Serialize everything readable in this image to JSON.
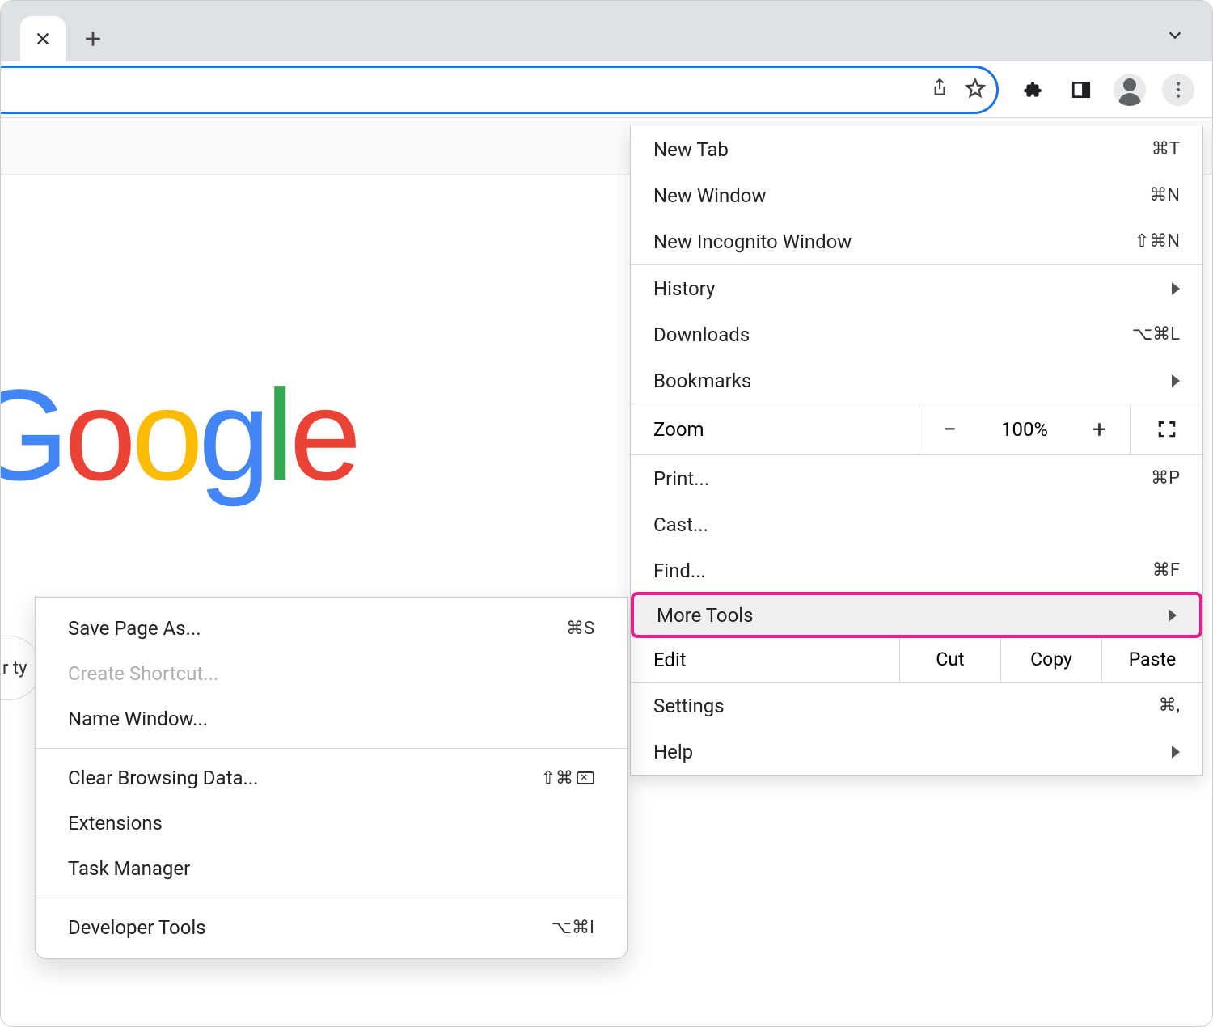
{
  "page": {
    "logo_chars": [
      "G",
      "o",
      "o",
      "g",
      "l",
      "e"
    ],
    "search_fragment": "r ty"
  },
  "menu": {
    "new_tab": {
      "label": "New Tab",
      "shortcut": "⌘T"
    },
    "new_window": {
      "label": "New Window",
      "shortcut": "⌘N"
    },
    "new_incognito": {
      "label": "New Incognito Window",
      "shortcut": "⇧⌘N"
    },
    "history": {
      "label": "History"
    },
    "downloads": {
      "label": "Downloads",
      "shortcut": "⌥⌘L"
    },
    "bookmarks": {
      "label": "Bookmarks"
    },
    "zoom": {
      "label": "Zoom",
      "minus": "−",
      "value": "100%",
      "plus": "+"
    },
    "print": {
      "label": "Print...",
      "shortcut": "⌘P"
    },
    "cast": {
      "label": "Cast..."
    },
    "find": {
      "label": "Find...",
      "shortcut": "⌘F"
    },
    "more_tools": {
      "label": "More Tools"
    },
    "edit": {
      "label": "Edit",
      "cut": "Cut",
      "copy": "Copy",
      "paste": "Paste"
    },
    "settings": {
      "label": "Settings",
      "shortcut": "⌘,"
    },
    "help": {
      "label": "Help"
    }
  },
  "submenu": {
    "save_page": {
      "label": "Save Page As...",
      "shortcut": "⌘S"
    },
    "create_shortcut": {
      "label": "Create Shortcut..."
    },
    "name_window": {
      "label": "Name Window..."
    },
    "clear_browsing": {
      "label": "Clear Browsing Data...",
      "shortcut_prefix": "⇧⌘"
    },
    "extensions": {
      "label": "Extensions"
    },
    "task_manager": {
      "label": "Task Manager"
    },
    "developer_tools": {
      "label": "Developer Tools",
      "shortcut": "⌥⌘I"
    }
  }
}
